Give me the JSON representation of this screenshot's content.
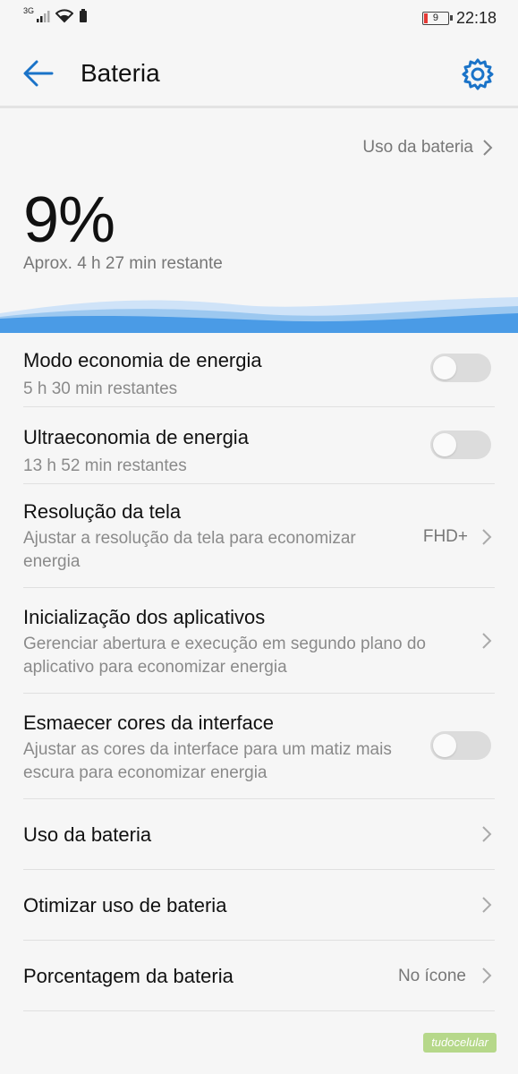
{
  "status_bar": {
    "network": "3G",
    "battery_level": "9",
    "time": "22:18"
  },
  "header": {
    "title": "Bateria",
    "back_icon": "arrow-left-icon",
    "settings_icon": "gear-icon"
  },
  "summary": {
    "usage_link": "Uso da bateria",
    "percent": "9%",
    "remaining": "Aprox. 4 h 27 min restante"
  },
  "items": [
    {
      "title": "Modo economia de energia",
      "subtitle": "5 h 30 min restantes",
      "toggle": false
    },
    {
      "title": "Ultraeconomia de energia",
      "subtitle": "13 h 52 min restantes",
      "toggle": false
    },
    {
      "title": "Resolução da tela",
      "subtitle": "Ajustar a resolução da tela para economizar energia",
      "value": "FHD+"
    },
    {
      "title": "Inicialização dos aplicativos",
      "subtitle": "Gerenciar abertura e execução em segundo plano do aplicativo para economizar energia"
    },
    {
      "title": "Esmaecer cores da interface",
      "subtitle": "Ajustar as cores da interface para um matiz mais escura para economizar energia",
      "toggle": false
    },
    {
      "title": "Uso da bateria"
    },
    {
      "title": "Otimizar uso de bateria"
    },
    {
      "title": "Porcentagem da bateria",
      "value": "No ícone"
    }
  ],
  "watermark": "tudocelular",
  "colors": {
    "accent": "#1a73c8",
    "wave": "#4a9be6",
    "battery_low": "#e53935"
  }
}
